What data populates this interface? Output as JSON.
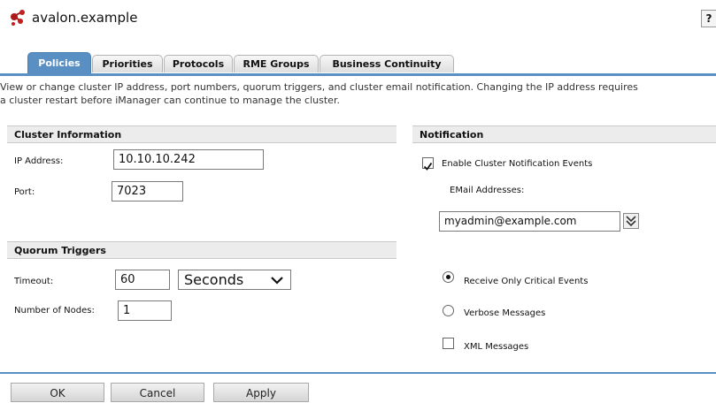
{
  "header": {
    "title": "avalon.example",
    "help_label": "?"
  },
  "tabs": [
    {
      "label": "Policies"
    },
    {
      "label": "Priorities"
    },
    {
      "label": "Protocols"
    },
    {
      "label": "RME Groups"
    },
    {
      "label": "Business Continuity"
    }
  ],
  "description": {
    "line1": "View or change cluster IP address, port numbers, quorum triggers, and cluster email notification. Changing the IP address requires",
    "line2": "a cluster restart before iManager can continue to manage the cluster."
  },
  "cluster_info": {
    "heading": "Cluster Information",
    "ip_label": "IP Address:",
    "ip_value": "10.10.10.242",
    "port_label": "Port:",
    "port_value": "7023"
  },
  "quorum": {
    "heading": "Quorum Triggers",
    "timeout_label": "Timeout:",
    "timeout_value": "60",
    "timeout_unit": "Seconds",
    "nodes_label": "Number of Nodes:",
    "nodes_value": "1"
  },
  "notification": {
    "heading": "Notification",
    "enable_label": "Enable Cluster Notification Events",
    "enable_checked": true,
    "email_label": "EMail Addresses:",
    "email_value": "myadmin@example.com",
    "critical_label": "Receive Only Critical Events",
    "verbose_label": "Verbose Messages",
    "xml_label": "XML Messages"
  },
  "buttons": {
    "ok": "OK",
    "cancel": "Cancel",
    "apply": "Apply"
  },
  "colors": {
    "accent": "#5a8fc4",
    "section_bg": "#ececec"
  }
}
